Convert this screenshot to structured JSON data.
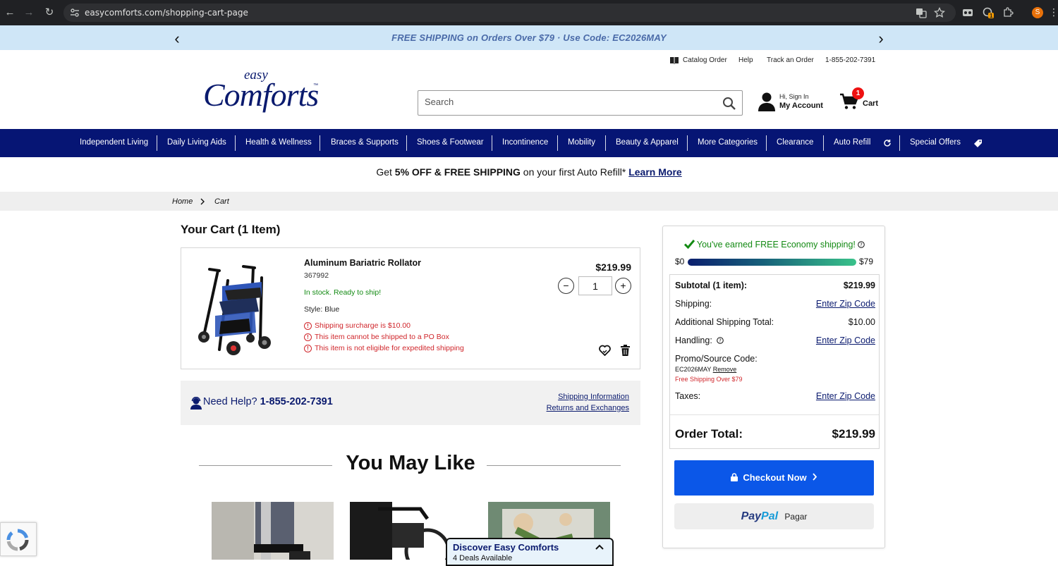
{
  "browser": {
    "url": "easycomforts.com/shopping-cart-page",
    "profile_initial": "S",
    "extension_badge": "1"
  },
  "promo_bar": {
    "text": "FREE SHIPPING on Orders Over $79 · Use Code: EC2026MAY"
  },
  "utility_nav": {
    "catalog": "Catalog Order",
    "help": "Help",
    "track": "Track an Order",
    "phone": "1-855-202-7391"
  },
  "logo": {
    "small": "easy",
    "big": "Comforts",
    "tm": "™"
  },
  "search": {
    "placeholder": "Search"
  },
  "account": {
    "greeting": "Hi, Sign In",
    "label": "My Account"
  },
  "cart_icon": {
    "count": "1",
    "label": "Cart"
  },
  "main_nav": [
    "Independent Living",
    "Daily Living Aids",
    "Health & Wellness",
    "Braces & Supports",
    "Shoes & Footwear",
    "Incontinence",
    "Mobility",
    "Beauty & Apparel",
    "More Categories",
    "Clearance",
    "Auto Refill",
    "Special Offers"
  ],
  "auto_refill_banner": {
    "prefix": "Get ",
    "bold": "5% OFF & FREE SHIPPING",
    "suffix": " on your first Auto Refill* ",
    "link": "Learn More"
  },
  "breadcrumb": {
    "home": "Home",
    "current": "Cart"
  },
  "cart": {
    "title": "Your Cart (1 Item)",
    "item": {
      "name": "Aluminum Bariatric Rollator",
      "sku": "367992",
      "stock": "In stock. Ready to ship!",
      "style": "Style: Blue",
      "warnings": [
        "Shipping surcharge is $10.00",
        "This item cannot be shipped to a PO Box",
        "This item is not eligible for expedited shipping"
      ],
      "price": "$219.99",
      "quantity": "1",
      "minus": "−",
      "plus": "+"
    }
  },
  "help": {
    "label": "Need Help? ",
    "phone": "1-855-202-7391",
    "shipping_link": "Shipping Information",
    "returns_link": "Returns and Exchanges"
  },
  "may_like": {
    "title": "You May Like"
  },
  "discover": {
    "title": "Discover Easy Comforts",
    "subtitle": "4 Deals Available"
  },
  "summary": {
    "earned": "You've earned FREE Economy shipping!",
    "progress_min": "$0",
    "progress_max": "$79",
    "progress_fraction": 1.0,
    "subtotal_label": "Subtotal (1 item):",
    "subtotal_value": "$219.99",
    "shipping_label": "Shipping:",
    "shipping_link": "Enter Zip Code",
    "additional_label": "Additional Shipping Total:",
    "additional_value": "$10.00",
    "handling_label": "Handling:",
    "handling_link": "Enter Zip Code",
    "promo_label": "Promo/Source Code:",
    "promo_code": "EC2026MAY",
    "promo_remove": "Remove",
    "promo_note": "Free Shipping Over $79",
    "taxes_label": "Taxes:",
    "taxes_link": "Enter Zip Code",
    "total_label": "Order Total:",
    "total_value": "$219.99",
    "checkout": "Checkout Now",
    "paypal_brand_1": "Pay",
    "paypal_brand_2": "Pal",
    "paypal_label": "Pagar"
  },
  "colors": {
    "nav_bg": "#061574",
    "promo_bg": "#cfe6f7",
    "checkout_blue": "#0b57e8",
    "success_green": "#138a13",
    "warning_red": "#d0262b"
  }
}
